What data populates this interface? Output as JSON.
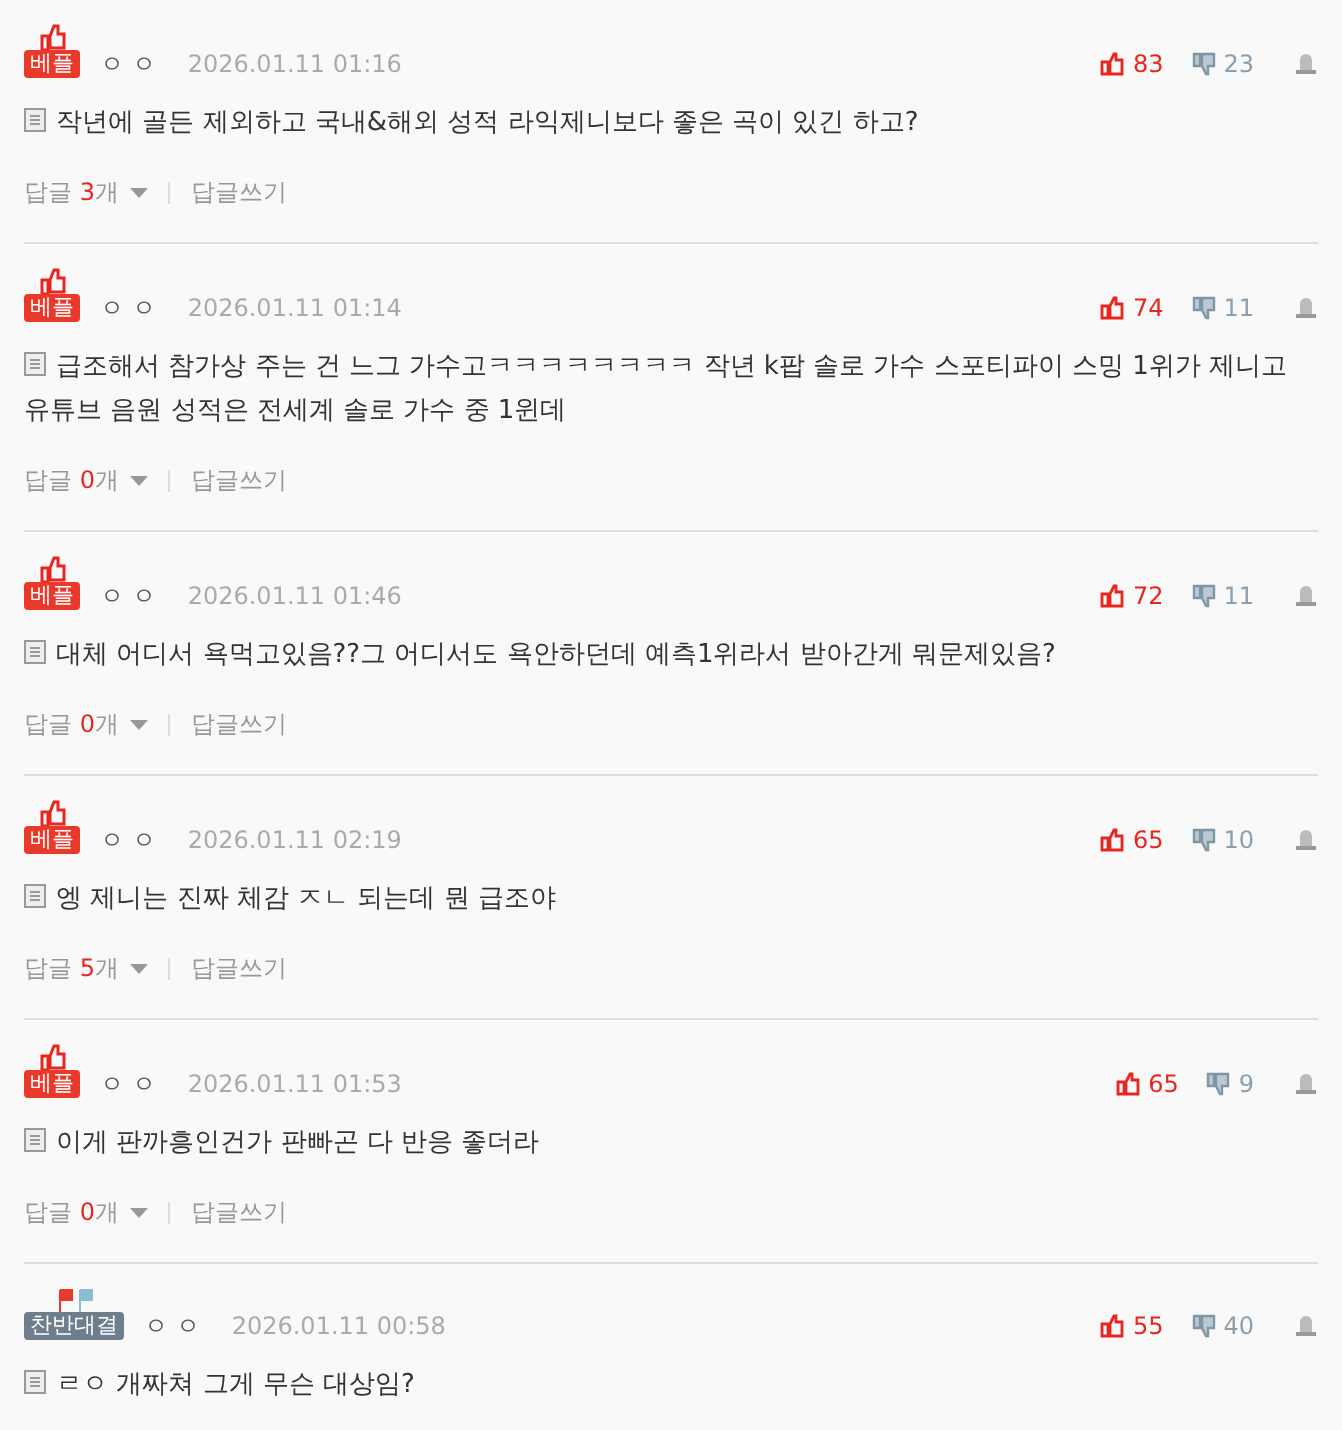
{
  "comments": [
    {
      "badge": {
        "kind": "best",
        "label": "베플"
      },
      "author": "ㅇ ㅇ",
      "date": "2026.01.11 01:16",
      "body": "작년에 골든 제외하고 국내&해외 성적 라익제니보다 좋은 곡이 있긴 하고?",
      "up": "83",
      "down": "23",
      "reply_label": "답글",
      "reply_count": "3",
      "reply_unit": "개",
      "write_reply": "답글쓰기"
    },
    {
      "badge": {
        "kind": "best",
        "label": "베플"
      },
      "author": "ㅇ ㅇ",
      "date": "2026.01.11 01:14",
      "body": "급조해서 참가상 주는 건 느그 가수고ㅋㅋㅋㅋㅋㅋㅋㅋ 작년 k팝 솔로 가수 스포티파이 스밍 1위가 제니고 유튜브 음원 성적은 전세계 솔로 가수 중 1윈데",
      "up": "74",
      "down": "11",
      "reply_label": "답글",
      "reply_count": "0",
      "reply_unit": "개",
      "write_reply": "답글쓰기"
    },
    {
      "badge": {
        "kind": "best",
        "label": "베플"
      },
      "author": "ㅇ ㅇ",
      "date": "2026.01.11 01:46",
      "body": "대체 어디서 욕먹고있음??그 어디서도 욕안하던데 예측1위라서 받아간게 뭐문제있음?",
      "up": "72",
      "down": "11",
      "reply_label": "답글",
      "reply_count": "0",
      "reply_unit": "개",
      "write_reply": "답글쓰기"
    },
    {
      "badge": {
        "kind": "best",
        "label": "베플"
      },
      "author": "ㅇ ㅇ",
      "date": "2026.01.11 02:19",
      "body": "엥 제니는 진짜 체감 ㅈㄴ 되는데 뭔 급조야",
      "up": "65",
      "down": "10",
      "reply_label": "답글",
      "reply_count": "5",
      "reply_unit": "개",
      "write_reply": "답글쓰기"
    },
    {
      "badge": {
        "kind": "best",
        "label": "베플"
      },
      "author": "ㅇ ㅇ",
      "date": "2026.01.11 01:53",
      "body": "이게 판까흥인건가 판빠곤 다 반응 좋더라",
      "up": "65",
      "down": "9",
      "reply_label": "답글",
      "reply_count": "0",
      "reply_unit": "개",
      "write_reply": "답글쓰기"
    },
    {
      "badge": {
        "kind": "versus",
        "label": "찬반대결"
      },
      "author": "ㅇ ㅇ",
      "date": "2026.01.11 00:58",
      "body": "ㄹㅇ 개짜쳐 그게 무슨 대상임?",
      "up": "55",
      "down": "40"
    }
  ]
}
